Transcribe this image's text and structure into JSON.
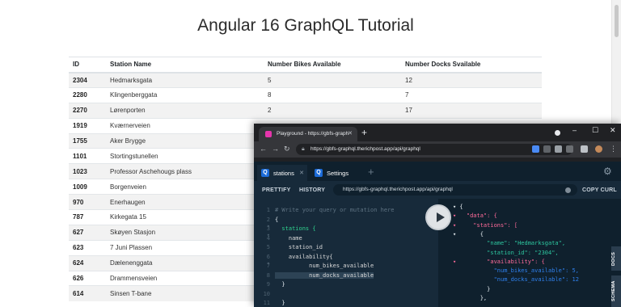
{
  "page": {
    "title": "Angular 16 GraphQL Tutorial",
    "columns": [
      "ID",
      "Station Name",
      "Number Bikes Available",
      "Number Docks Svailable"
    ],
    "rows": [
      [
        "2304",
        "Hedmarksgata",
        "5",
        "12"
      ],
      [
        "2280",
        "Klingenberggata",
        "8",
        "7"
      ],
      [
        "2270",
        "Lørenporten",
        "2",
        "17"
      ],
      [
        "1919",
        "Kværnerveien",
        "",
        ""
      ],
      [
        "1755",
        "Aker Brygge",
        "",
        ""
      ],
      [
        "1101",
        "Stortingstunellen",
        "",
        ""
      ],
      [
        "1023",
        "Professor Aschehougs plass",
        "",
        ""
      ],
      [
        "1009",
        "Borgenveien",
        "",
        ""
      ],
      [
        "970",
        "Enerhaugen",
        "",
        ""
      ],
      [
        "787",
        "Kirkegata 15",
        "",
        ""
      ],
      [
        "627",
        "Skøyen Stasjon",
        "",
        ""
      ],
      [
        "623",
        "7 Juni Plassen",
        "",
        ""
      ],
      [
        "624",
        "Dælenenggata",
        "",
        ""
      ],
      [
        "626",
        "Drammensveien",
        "",
        ""
      ],
      [
        "614",
        "Sinsen T-bane",
        "",
        ""
      ]
    ]
  },
  "browser": {
    "tab_title": "Playground - https://gbfs-graph",
    "url": "https://gbfs-graphql.therichpost.app/api/graphql",
    "close_glyph": "✕",
    "new_tab_glyph": "+",
    "minimize": "–",
    "maximize": "☐",
    "close": "✕"
  },
  "playground": {
    "tabs": [
      {
        "label": "stations",
        "icon": "Q"
      },
      {
        "label": "Settings",
        "icon": "Q"
      }
    ],
    "add_tab": "+",
    "prettify": "PRETTIFY",
    "history": "HISTORY",
    "endpoint": "https://gbfs-graphql.therichpost.app/api/graphql",
    "copy_curl": "COPY CURL",
    "docs": "DOCS",
    "schema": "SCHEMA",
    "editor_lines": [
      {
        "n": "1",
        "text": "# Write your query or mutation here"
      },
      {
        "n": "2 ▾",
        "text": "{"
      },
      {
        "n": "3 ▾",
        "text": "  stations {"
      },
      {
        "n": "4",
        "text": "    name"
      },
      {
        "n": "5",
        "text": "    station_id"
      },
      {
        "n": "6 ▾",
        "text": "    availability{"
      },
      {
        "n": "7",
        "text": "          num_bikes_available"
      },
      {
        "n": "8",
        "text": "          num_docks_available"
      },
      {
        "n": "9",
        "text": "  }"
      },
      {
        "n": "10",
        "text": ""
      },
      {
        "n": "11",
        "text": "  }"
      }
    ],
    "result_lines": [
      "▾ {",
      "▾   \"data\": {",
      "▾     \"stations\": [",
      "▾       {",
      "          \"name\": \"Hedmarksgata\",",
      "          \"station_id\": \"2304\",",
      "▾         \"availability\": {",
      "            \"num_bikes_available\": 5,",
      "            \"num_docks_available\": 12",
      "          }",
      "        },"
    ]
  },
  "colors": {
    "graphql_pink": "#e535ab",
    "playground_bg": "#172a3a",
    "result_bg": "#0f202d",
    "string_value": "#2dc69f",
    "number_value": "#2f80ed",
    "key_color": "#ff6b9a"
  }
}
